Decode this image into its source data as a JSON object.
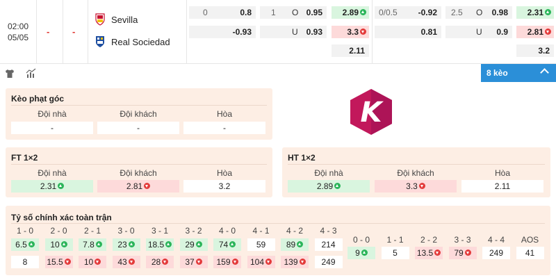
{
  "match": {
    "time": "02:00",
    "date": "05/05",
    "score_home": "-",
    "score_away": "-",
    "home_team": "Sevilla",
    "away_team": "Real Sociedad"
  },
  "odds": {
    "ft_handicap": {
      "line": "0",
      "home": "0.8",
      "away": "-0.93"
    },
    "ft_overunder": {
      "line": "1",
      "over_label": "O",
      "over": "0.95",
      "under_label": "U",
      "under": "0.93"
    },
    "ft_1x2": {
      "home": "2.89",
      "away": "3.3",
      "draw": "2.11"
    },
    "ht_handicap": {
      "line": "0/0.5",
      "home": "-0.92",
      "away": "0.81"
    },
    "ht_overunder": {
      "line": "2.5",
      "over_label": "O",
      "over": "0.98",
      "under_label": "U",
      "under": "0.9"
    },
    "ht_1x2": {
      "home": "2.31",
      "away": "2.81",
      "draw": "3.2"
    }
  },
  "toolbar": {
    "keo_label": "8 kèo"
  },
  "corner": {
    "title": "Kèo phạt góc",
    "headers": [
      "Đội nhà",
      "Đội khách",
      "Hòa"
    ],
    "values": [
      "-",
      "-",
      "-"
    ]
  },
  "ft1x2": {
    "title": "FT 1×2",
    "headers": [
      "Đội nhà",
      "Đội khách",
      "Hòa"
    ],
    "values": [
      "2.31",
      "2.81",
      "3.2"
    ]
  },
  "ht1x2": {
    "title": "HT 1×2",
    "headers": [
      "Đội nhà",
      "Đội khách",
      "Hòa"
    ],
    "values": [
      "2.89",
      "3.3",
      "2.11"
    ]
  },
  "correct_score": {
    "title": "Tỷ số chính xác toàn trận",
    "home_cols": [
      "1 - 0",
      "2 - 0",
      "2 - 1",
      "3 - 0",
      "3 - 1",
      "3 - 2",
      "4 - 0",
      "4 - 1",
      "4 - 2",
      "4 - 3"
    ],
    "home_row1": [
      "6.5",
      "10",
      "7.8",
      "23",
      "18.5",
      "29",
      "74",
      "59",
      "89",
      "214"
    ],
    "home_row1_trend": [
      "up",
      "up",
      "up",
      "up",
      "up",
      "up",
      "up",
      "",
      "up",
      ""
    ],
    "home_row2": [
      "8",
      "15.5",
      "10",
      "43",
      "28",
      "37",
      "159",
      "104",
      "139",
      "249"
    ],
    "home_row2_trend": [
      "",
      "down",
      "down",
      "down",
      "down",
      "down",
      "down",
      "down",
      "down",
      ""
    ],
    "draw_cols": [
      "0 - 0",
      "1 - 1",
      "2 - 2",
      "3 - 3",
      "4 - 4",
      "AOS"
    ],
    "draw_vals": [
      "9",
      "5",
      "13.5",
      "79",
      "249",
      "41"
    ],
    "draw_trend": [
      "up",
      "",
      "down",
      "down",
      "",
      ""
    ]
  },
  "colors": {
    "accent": "#2b8fd8",
    "up": "#2bb55a",
    "down": "#e33b3b",
    "panel_bg": "#fdeee4",
    "logo": "#c2185b"
  }
}
